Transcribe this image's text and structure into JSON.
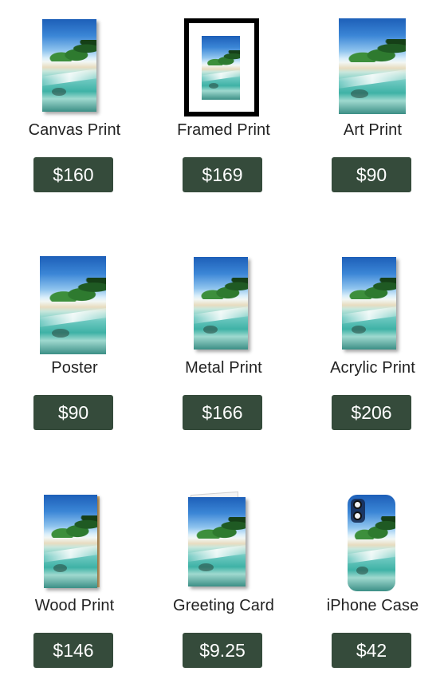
{
  "products": [
    {
      "name": "Canvas Print",
      "price": "$160",
      "thumb": "canvas"
    },
    {
      "name": "Framed Print",
      "price": "$169",
      "thumb": "framed"
    },
    {
      "name": "Art Print",
      "price": "$90",
      "thumb": "art"
    },
    {
      "name": "Poster",
      "price": "$90",
      "thumb": "poster"
    },
    {
      "name": "Metal Print",
      "price": "$166",
      "thumb": "metal"
    },
    {
      "name": "Acrylic Print",
      "price": "$206",
      "thumb": "acrylic"
    },
    {
      "name": "Wood Print",
      "price": "$146",
      "thumb": "wood"
    },
    {
      "name": "Greeting Card",
      "price": "$9.25",
      "thumb": "card"
    },
    {
      "name": "iPhone Case",
      "price": "$42",
      "thumb": "phone"
    }
  ],
  "colors": {
    "button_bg": "#354b3b",
    "button_text": "#ffffff",
    "label_text": "#222222",
    "background": "#ffffff"
  }
}
